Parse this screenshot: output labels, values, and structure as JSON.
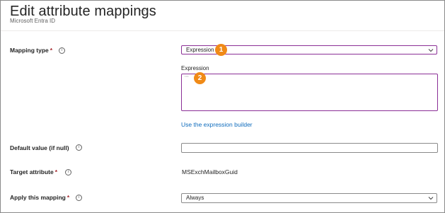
{
  "header": {
    "title": "Edit attribute mappings",
    "more_icon": "ellipsis-icon",
    "more_label": "···",
    "subtitle": "Microsoft Entra ID"
  },
  "fields": {
    "mapping_type": {
      "label": "Mapping type",
      "required_mark": "*",
      "value": "Expression",
      "callout": "1"
    },
    "expression": {
      "label": "Expression",
      "value": "\"\"",
      "callout": "2"
    },
    "expression_builder_link": "Use the expression builder",
    "default_value": {
      "label": "Default value (if null)",
      "value": ""
    },
    "target_attribute": {
      "label": "Target attribute",
      "required_mark": "*",
      "value": "MSExchMailboxGuid"
    },
    "apply_mapping": {
      "label": "Apply this mapping",
      "required_mark": "*",
      "value": "Always"
    }
  },
  "colors": {
    "accent_focus": "#8b2f96",
    "callout_badge": "#f08a17",
    "link": "#0f6cbd",
    "required": "#a4262c"
  }
}
